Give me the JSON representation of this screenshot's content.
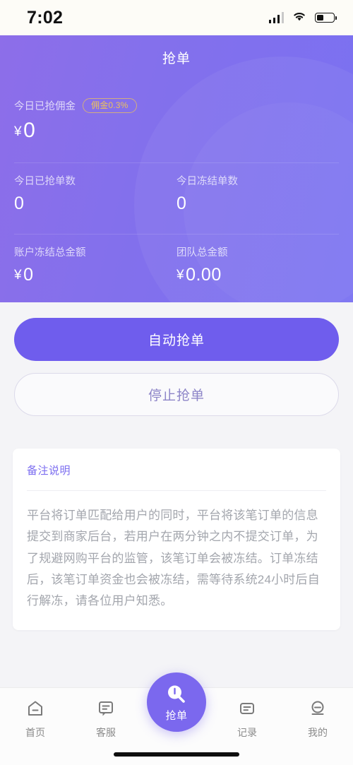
{
  "status_bar": {
    "time": "7:02",
    "signal_icon": "cellular-signal-icon",
    "wifi_icon": "wifi-icon",
    "battery_icon": "battery-icon"
  },
  "header": {
    "title": "抢单",
    "commission": {
      "label": "今日已抢佣金",
      "badge": "佣金0.3%",
      "currency": "¥",
      "value": "0"
    },
    "stats_row_2": [
      {
        "label": "今日已抢单数",
        "value": "0"
      },
      {
        "label": "今日冻结单数",
        "value": "0"
      }
    ],
    "stats_row_3": [
      {
        "label": "账户冻结总金额",
        "currency": "¥",
        "value": "0"
      },
      {
        "label": "团队总金额",
        "currency": "¥",
        "value": "0.00"
      }
    ]
  },
  "actions": {
    "auto_grab": "自动抢单",
    "stop_grab": "停止抢单"
  },
  "notice": {
    "title": "备注说明",
    "body": "平台将订单匹配给用户的同时，平台将该笔订单的信息提交到商家后台，若用户在两分钟之内不提交订单，为了规避网购平台的监管，该笔订单会被冻结。订单冻结后，该笔订单资金也会被冻结，需等待系统24小时后自行解冻，请各位用户知悉。"
  },
  "tabbar": {
    "items": [
      {
        "label": "首页",
        "icon": "home-icon"
      },
      {
        "label": "客服",
        "icon": "chat-bubble-icon"
      },
      {
        "label": "抢单",
        "icon": "search-icon"
      },
      {
        "label": "记录",
        "icon": "document-icon"
      },
      {
        "label": "我的",
        "icon": "person-icon"
      }
    ],
    "active": "抢单"
  },
  "colors": {
    "brand_purple": "#7b68ee",
    "header_gradient_start": "#8d6ee9",
    "header_gradient_end": "#7a71f2",
    "badge_gold": "#ecc15c",
    "page_background": "#f4f4f7",
    "muted_text": "#a3a6ad"
  }
}
